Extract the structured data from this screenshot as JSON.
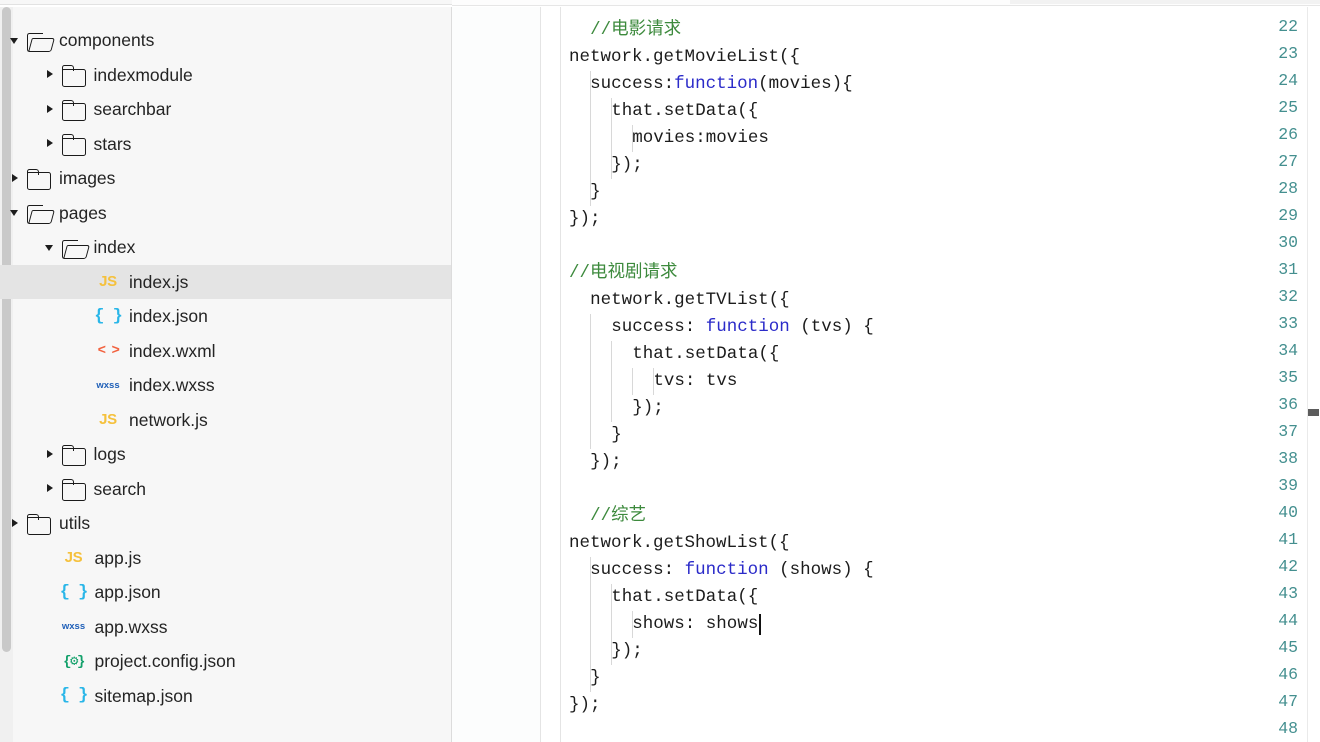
{
  "app": {
    "type": "code-editor-ide",
    "colors": {
      "sidebar_bg": "#f7f7f7",
      "editor_bg": "#ffffff",
      "selection_bg": "#e4e4e4",
      "line_number": "#3a8a8a",
      "comment": "#3d8a3d",
      "keyword": "#2b2bc9",
      "text": "#1c1c1c",
      "icon_js": "#f5c13d",
      "icon_json": "#29b6e8",
      "icon_wxml": "#f2623f",
      "icon_wxss": "#2060b8",
      "icon_config": "#12a06a"
    }
  },
  "sidebar": {
    "name": "file-explorer",
    "items": [
      {
        "label": "components",
        "depth": 0,
        "kind": "folder",
        "state": "expanded",
        "icon": "folder-open-icon",
        "selected": false
      },
      {
        "label": "indexmodule",
        "depth": 1,
        "kind": "folder",
        "state": "collapsed",
        "icon": "folder-icon",
        "selected": false
      },
      {
        "label": "searchbar",
        "depth": 1,
        "kind": "folder",
        "state": "collapsed",
        "icon": "folder-icon",
        "selected": false
      },
      {
        "label": "stars",
        "depth": 1,
        "kind": "folder",
        "state": "collapsed",
        "icon": "folder-icon",
        "selected": false
      },
      {
        "label": "images",
        "depth": 0,
        "kind": "folder",
        "state": "collapsed",
        "icon": "folder-icon",
        "selected": false
      },
      {
        "label": "pages",
        "depth": 0,
        "kind": "folder",
        "state": "expanded",
        "icon": "folder-open-icon",
        "selected": false
      },
      {
        "label": "index",
        "depth": 1,
        "kind": "folder",
        "state": "expanded",
        "icon": "folder-open-icon",
        "selected": false
      },
      {
        "label": "index.js",
        "depth": 2,
        "kind": "file",
        "state": "none",
        "icon": "js-file-icon",
        "selected": true,
        "badge": "JS"
      },
      {
        "label": "index.json",
        "depth": 2,
        "kind": "file",
        "state": "none",
        "icon": "json-file-icon",
        "selected": false,
        "badge": "{ }"
      },
      {
        "label": "index.wxml",
        "depth": 2,
        "kind": "file",
        "state": "none",
        "icon": "wxml-file-icon",
        "selected": false,
        "badge": "< >"
      },
      {
        "label": "index.wxss",
        "depth": 2,
        "kind": "file",
        "state": "none",
        "icon": "wxss-file-icon",
        "selected": false,
        "badge": "wxss"
      },
      {
        "label": "network.js",
        "depth": 2,
        "kind": "file",
        "state": "none",
        "icon": "js-file-icon",
        "selected": false,
        "badge": "JS"
      },
      {
        "label": "logs",
        "depth": 1,
        "kind": "folder",
        "state": "collapsed",
        "icon": "folder-icon",
        "selected": false
      },
      {
        "label": "search",
        "depth": 1,
        "kind": "folder",
        "state": "collapsed",
        "icon": "folder-icon",
        "selected": false
      },
      {
        "label": "utils",
        "depth": 0,
        "kind": "folder",
        "state": "collapsed",
        "icon": "folder-icon",
        "selected": false
      },
      {
        "label": "app.js",
        "depth": 1,
        "kind": "file",
        "state": "none",
        "icon": "js-file-icon",
        "selected": false,
        "badge": "JS"
      },
      {
        "label": "app.json",
        "depth": 1,
        "kind": "file",
        "state": "none",
        "icon": "json-file-icon",
        "selected": false,
        "badge": "{ }"
      },
      {
        "label": "app.wxss",
        "depth": 1,
        "kind": "file",
        "state": "none",
        "icon": "wxss-file-icon",
        "selected": false,
        "badge": "wxss"
      },
      {
        "label": "project.config.json",
        "depth": 1,
        "kind": "file",
        "state": "none",
        "icon": "config-file-icon",
        "selected": false,
        "badge": "{⚙}"
      },
      {
        "label": "sitemap.json",
        "depth": 1,
        "kind": "file",
        "state": "none",
        "icon": "json-file-icon",
        "selected": false,
        "badge": "{ }"
      }
    ]
  },
  "editor": {
    "name": "code-editor",
    "language": "javascript",
    "first_visible_line": 22,
    "last_visible_line": 48,
    "cursor": {
      "line": 44,
      "after_text": "shows: shows"
    },
    "lines": [
      {
        "n": 22,
        "indent": 1,
        "tokens": [
          {
            "t": "//电影请求",
            "c": "cm"
          }
        ]
      },
      {
        "n": 23,
        "indent": 0,
        "tokens": [
          {
            "t": "network.getMovieList({",
            "c": ""
          }
        ]
      },
      {
        "n": 24,
        "indent": 1,
        "tokens": [
          {
            "t": "success:",
            "c": ""
          },
          {
            "t": "function",
            "c": "kw"
          },
          {
            "t": "(movies){",
            "c": ""
          }
        ]
      },
      {
        "n": 25,
        "indent": 2,
        "tokens": [
          {
            "t": "that.setData({",
            "c": ""
          }
        ]
      },
      {
        "n": 26,
        "indent": 3,
        "tokens": [
          {
            "t": "movies:movies",
            "c": ""
          }
        ]
      },
      {
        "n": 27,
        "indent": 2,
        "tokens": [
          {
            "t": "});",
            "c": ""
          }
        ]
      },
      {
        "n": 28,
        "indent": 1,
        "tokens": [
          {
            "t": "}",
            "c": ""
          }
        ]
      },
      {
        "n": 29,
        "indent": 0,
        "tokens": [
          {
            "t": "});",
            "c": ""
          }
        ]
      },
      {
        "n": 30,
        "indent": 0,
        "tokens": []
      },
      {
        "n": 31,
        "indent": 0,
        "tokens": [
          {
            "t": "//电视剧请求",
            "c": "cm"
          }
        ]
      },
      {
        "n": 32,
        "indent": 1,
        "tokens": [
          {
            "t": "network.getTVList({",
            "c": ""
          }
        ]
      },
      {
        "n": 33,
        "indent": 2,
        "tokens": [
          {
            "t": "success: ",
            "c": ""
          },
          {
            "t": "function",
            "c": "kw"
          },
          {
            "t": " (tvs) {",
            "c": ""
          }
        ]
      },
      {
        "n": 34,
        "indent": 3,
        "tokens": [
          {
            "t": "that.setData({",
            "c": ""
          }
        ]
      },
      {
        "n": 35,
        "indent": 4,
        "tokens": [
          {
            "t": "tvs: tvs",
            "c": ""
          }
        ]
      },
      {
        "n": 36,
        "indent": 3,
        "tokens": [
          {
            "t": "});",
            "c": ""
          }
        ]
      },
      {
        "n": 37,
        "indent": 2,
        "tokens": [
          {
            "t": "}",
            "c": ""
          }
        ]
      },
      {
        "n": 38,
        "indent": 1,
        "tokens": [
          {
            "t": "});",
            "c": ""
          }
        ]
      },
      {
        "n": 39,
        "indent": 0,
        "tokens": []
      },
      {
        "n": 40,
        "indent": 1,
        "tokens": [
          {
            "t": "//综艺",
            "c": "cm"
          }
        ]
      },
      {
        "n": 41,
        "indent": 0,
        "tokens": [
          {
            "t": "network.getShowList({",
            "c": ""
          }
        ]
      },
      {
        "n": 42,
        "indent": 1,
        "tokens": [
          {
            "t": "success: ",
            "c": ""
          },
          {
            "t": "function",
            "c": "kw"
          },
          {
            "t": " (shows) {",
            "c": ""
          }
        ]
      },
      {
        "n": 43,
        "indent": 2,
        "tokens": [
          {
            "t": "that.setData({",
            "c": ""
          }
        ]
      },
      {
        "n": 44,
        "indent": 3,
        "tokens": [
          {
            "t": "shows: shows",
            "c": ""
          }
        ]
      },
      {
        "n": 45,
        "indent": 2,
        "tokens": [
          {
            "t": "});",
            "c": ""
          }
        ]
      },
      {
        "n": 46,
        "indent": 1,
        "tokens": [
          {
            "t": "}",
            "c": ""
          }
        ]
      },
      {
        "n": 47,
        "indent": 0,
        "tokens": [
          {
            "t": "});",
            "c": ""
          }
        ]
      },
      {
        "n": 48,
        "indent": 0,
        "tokens": []
      }
    ]
  }
}
